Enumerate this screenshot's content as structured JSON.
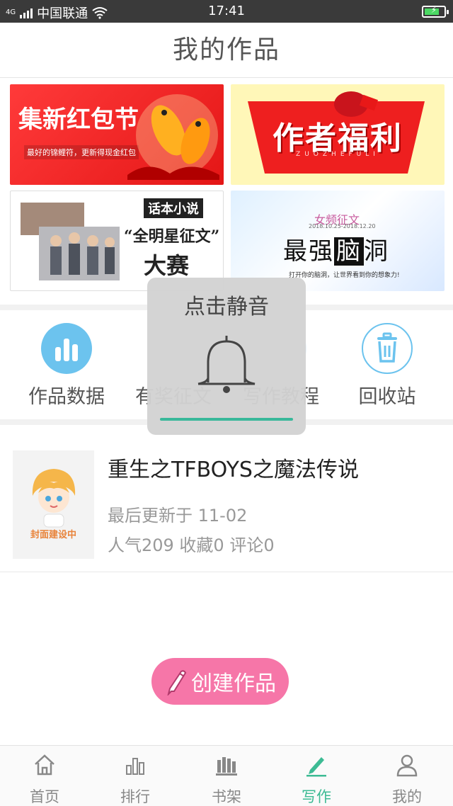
{
  "status_bar": {
    "network": "4G",
    "carrier": "中国联通",
    "time": "17:41"
  },
  "header": {
    "title": "我的作品"
  },
  "banners": [
    {
      "title": "集新红包节",
      "subtitle": "最好的锦鲤符，更新得现金红包"
    },
    {
      "title": "作者福利",
      "subtitle": "ZUOZHEFULI"
    },
    {
      "tag": "话本小说",
      "title": "“全明星征文”",
      "subtitle": "大赛"
    },
    {
      "tag": "女频征文",
      "title_a": "最强",
      "title_b": "脑",
      "title_c": "洞",
      "date": "2018.10.25-2018.12.20",
      "subtitle": "打开你的脑洞，让世界看到你的想象力!"
    }
  ],
  "tools": [
    {
      "label": "作品数据",
      "icon": "bar-chart-icon"
    },
    {
      "label": "有奖征文",
      "icon": "contest-icon"
    },
    {
      "label": "写作教程",
      "icon": "tutorial-icon"
    },
    {
      "label": "回收站",
      "icon": "trash-icon"
    }
  ],
  "overlay": {
    "text": "点击静音"
  },
  "work": {
    "title": "重生之TFBOYS之魔法传说",
    "cover_caption": "封面建设中",
    "updated": "最后更新于 11-02",
    "stats": "人气209 收藏0 评论0"
  },
  "create_button": {
    "label": "创建作品"
  },
  "tabbar": [
    {
      "label": "首页",
      "icon": "home-icon",
      "active": false
    },
    {
      "label": "排行",
      "icon": "ranking-icon",
      "active": false
    },
    {
      "label": "书架",
      "icon": "bookshelf-icon",
      "active": false
    },
    {
      "label": "写作",
      "icon": "pen-icon",
      "active": true
    },
    {
      "label": "我的",
      "icon": "profile-icon",
      "active": false
    }
  ],
  "colors": {
    "accent": "#3dbb94",
    "tool_blue": "#6cc3ee",
    "create_pink": "#f676a8"
  }
}
